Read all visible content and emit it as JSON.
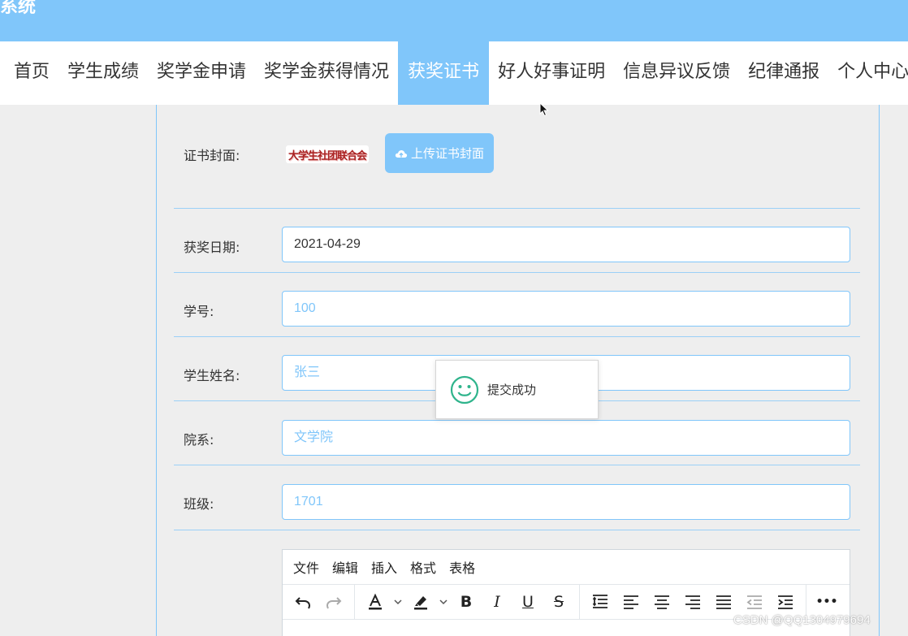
{
  "header": {
    "brand": "系统"
  },
  "nav": {
    "items": [
      "首页",
      "学生成绩",
      "奖学金申请",
      "奖学金获得情况",
      "获奖证书",
      "好人好事证明",
      "信息异议反馈",
      "纪律通报",
      "个人中心"
    ],
    "active": "获奖证书"
  },
  "form": {
    "cover": {
      "label": "证书封面:",
      "image_text": "大学生社团联合会",
      "upload_label": "上传证书封面"
    },
    "award_date": {
      "label": "获奖日期:",
      "value": "2021-04-29"
    },
    "student_id": {
      "label": "学号:",
      "value": "100"
    },
    "student_name": {
      "label": "学生姓名:",
      "value": "张三"
    },
    "department": {
      "label": "院系:",
      "value": "文学院"
    },
    "class": {
      "label": "班级:",
      "value": "1701"
    }
  },
  "editor": {
    "menus": [
      "文件",
      "编辑",
      "插入",
      "格式",
      "表格"
    ],
    "toolbar": {
      "undo": "↶",
      "redo": "↷",
      "bold": "B",
      "italic": "I",
      "underline": "U",
      "strike": "S",
      "more": "•••"
    }
  },
  "toast": {
    "message": "提交成功"
  },
  "watermark": "CSDN @QQ1304979694",
  "colors": {
    "accent": "#80c6fa",
    "toast_icon": "#2fb48c"
  }
}
